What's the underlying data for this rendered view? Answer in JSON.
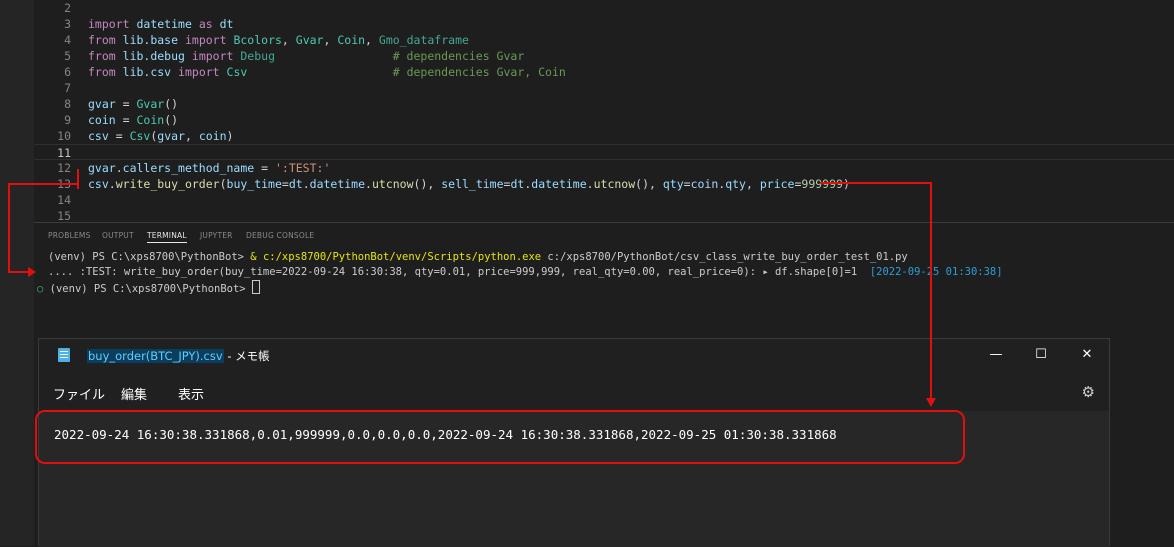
{
  "editor": {
    "lines": [
      {
        "n": "2",
        "t": ""
      },
      {
        "n": "3",
        "t": "import datetime as dt"
      },
      {
        "n": "4",
        "t": "from lib.base import Bcolors, Gvar, Coin, Gmo_dataframe"
      },
      {
        "n": "5",
        "t": "from lib.debug import Debug                 # dependencies Gvar"
      },
      {
        "n": "6",
        "t": "from lib.csv import Csv                     # dependencies Gvar, Coin"
      },
      {
        "n": "7",
        "t": ""
      },
      {
        "n": "8",
        "t": "gvar = Gvar()"
      },
      {
        "n": "9",
        "t": "coin = Coin()"
      },
      {
        "n": "10",
        "t": "csv = Csv(gvar, coin)"
      },
      {
        "n": "11",
        "t": ""
      },
      {
        "n": "12",
        "t": "gvar.callers_method_name = ':TEST:'"
      },
      {
        "n": "13",
        "t": "csv.write_buy_order(buy_time=dt.datetime.utcnow(), sell_time=dt.datetime.utcnow(), qty=coin.qty, price=999999)"
      },
      {
        "n": "14",
        "t": ""
      },
      {
        "n": "15",
        "t": ""
      }
    ]
  },
  "panel": {
    "tabs": [
      "PROBLEMS",
      "OUTPUT",
      "TERMINAL",
      "JUPYTER",
      "DEBUG CONSOLE"
    ],
    "active_tab": "TERMINAL",
    "terminal": {
      "line1_prompt": "(venv) PS C:\\xps8700\\PythonBot> ",
      "line1_amp": "& ",
      "line1_cmd": "c:/xps8700/PythonBot/venv/Scripts/python.exe",
      "line1_arg": " c:/xps8700/PythonBot/csv_class_write_buy_order_test_01.py",
      "line2_text": ".... :TEST: write_buy_order(buy_time=2022-09-24 16:30:38, qty=0.01, price=999,999, real_qty=0.00, real_price=0): ▸ df.shape[0]=1  ",
      "line2_time": "[2022-09-25 01:30:38]",
      "line3_prompt": "(venv) PS C:\\xps8700\\PythonBot> "
    }
  },
  "notepad": {
    "file_name": "buy_order(BTC_JPY).csv",
    "title_suffix": " - メモ帳",
    "menu": [
      "ファイル",
      "編集",
      "表示"
    ],
    "content": "2022-09-24 16:30:38.331868,0.01,999999,0.0,0.0,0.0,2022-09-24 16:30:38.331868,2022-09-25 01:30:38.331868",
    "window_buttons": {
      "minimize": "—",
      "maximize": "☐",
      "close": "✕"
    }
  },
  "colors": {
    "annotation": "#e01010",
    "accent": "#60cdff"
  }
}
